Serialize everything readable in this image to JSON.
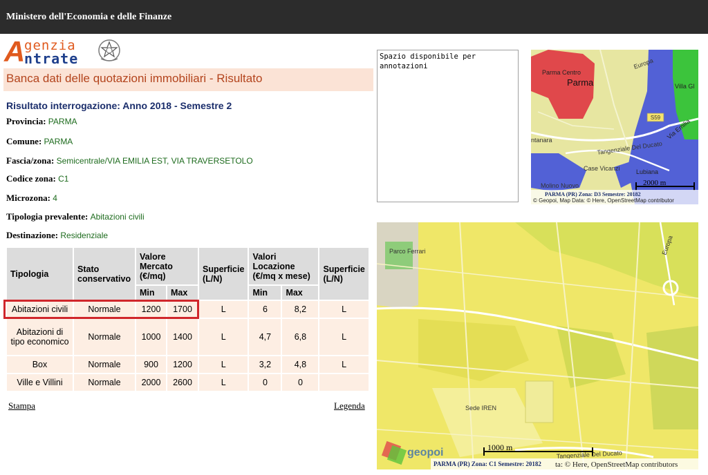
{
  "topbar": {
    "title": "Ministero dell'Economia e delle Finanze"
  },
  "logo": {
    "line1": "genzia",
    "line2": "ntrate",
    "initial": "A"
  },
  "banner": {
    "title": "Banca dati delle quotazioni immobiliari - Risultato"
  },
  "result": {
    "heading": "Risultato interrogazione: Anno 2018 - Semestre 2",
    "fields": [
      {
        "label": "Provincia:",
        "value": "PARMA"
      },
      {
        "label": "Comune:",
        "value": "PARMA"
      },
      {
        "label": "Fascia/zona:",
        "value": "Semicentrale/VIA EMILIA EST, VIA TRAVERSETOLO"
      },
      {
        "label": "Codice zona:",
        "value": "C1"
      },
      {
        "label": "Microzona:",
        "value": "4"
      },
      {
        "label": "Tipologia prevalente:",
        "value": "Abitazioni civili"
      },
      {
        "label": "Destinazione:",
        "value": "Residenziale"
      }
    ]
  },
  "table": {
    "headers": {
      "tipologia": "Tipologia",
      "stato": "Stato conservativo",
      "valore_mercato": "Valore Mercato (€/mq)",
      "superficie1": "Superficie (L/N)",
      "valori_locazione": "Valori Locazione (€/mq x mese)",
      "superficie2": "Superficie (L/N)",
      "min": "Min",
      "max": "Max"
    },
    "rows": [
      {
        "tipologia": "Abitazioni civili",
        "stato": "Normale",
        "vm_min": "1200",
        "vm_max": "1700",
        "sup1": "L",
        "vl_min": "6",
        "vl_max": "8,2",
        "sup2": "L"
      },
      {
        "tipologia": "Abitazioni di tipo economico",
        "stato": "Normale",
        "vm_min": "1000",
        "vm_max": "1400",
        "sup1": "L",
        "vl_min": "4,7",
        "vl_max": "6,8",
        "sup2": "L"
      },
      {
        "tipologia": "Box",
        "stato": "Normale",
        "vm_min": "900",
        "vm_max": "1200",
        "sup1": "L",
        "vl_min": "3,2",
        "vl_max": "4,8",
        "sup2": "L"
      },
      {
        "tipologia": "Ville e Villini",
        "stato": "Normale",
        "vm_min": "2000",
        "vm_max": "2600",
        "sup1": "L",
        "vl_min": "0",
        "vl_max": "0",
        "sup2": ""
      }
    ]
  },
  "links": {
    "stampa": "Stampa",
    "legenda": "Legenda"
  },
  "notes": {
    "value": "Spazio disponibile per\nannotazioni"
  },
  "map_small": {
    "labels": [
      "Parma Centro",
      "Parma",
      "Villa Gl",
      "Via Emilia",
      "Tangenziale Del Ducato",
      "Case Vicanzi",
      "Lubiana",
      "ntanara",
      "Molino Nuovo",
      "Europa",
      "S59"
    ],
    "scale": "2000 m",
    "caption": "PARMA (PR) Zona: D3 Semestre: 20182",
    "credits": "© Geopoi, Map Data: © Here, OpenStreetMap contributor"
  },
  "map_large": {
    "labels": [
      "Parco Ferrari",
      "Sede IREN",
      "Tangenziale Del Ducato",
      "Europa"
    ],
    "scale": "1000 m",
    "caption": "PARMA (PR) Zona: C1 Semestre: 20182",
    "credits": "ta: © Here, OpenStreetMap contributors",
    "brand": "geopoi"
  },
  "colors": {
    "topbar": "#2c2c2c",
    "banner_bg": "#fbe3d6",
    "banner_text": "#b3441d",
    "value_green": "#1d6b1d",
    "highlight": "#d0262b"
  }
}
